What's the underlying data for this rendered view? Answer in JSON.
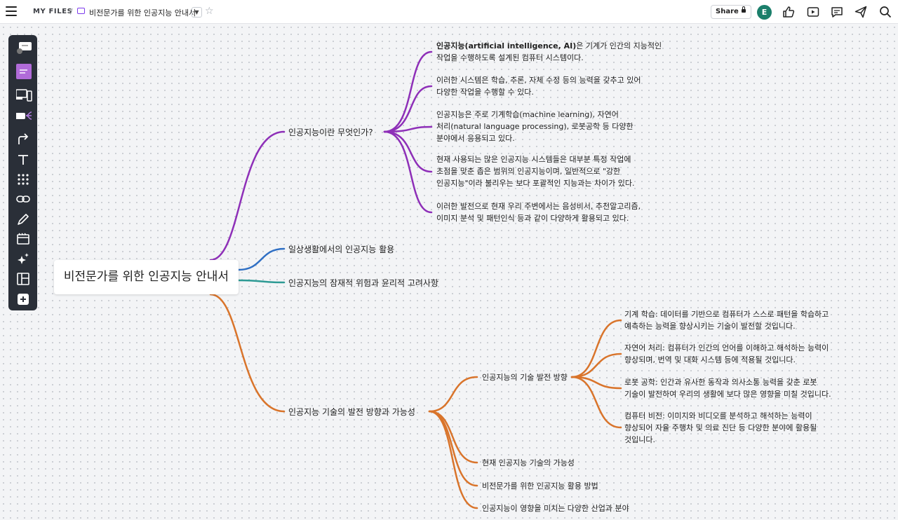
{
  "topbar": {
    "section": "MY FILES",
    "separator": "/",
    "title": "비전문가를 위한 인공지능 안내서",
    "share_label": "Share",
    "avatar_letter": "E"
  },
  "colors": {
    "purple": "#8e2fb8",
    "blue": "#2f6fc4",
    "teal": "#2d9a94",
    "orange": "#d9742b",
    "toolbar_bg": "#2a2f38",
    "avatar_bg": "#1b7f6b"
  },
  "toolbar": {
    "tools": [
      "comment-tool-icon",
      "sticky-note-icon",
      "devices-icon",
      "mindmap-icon",
      "connector-icon",
      "text-icon",
      "grid-icon",
      "link-icon",
      "pen-icon",
      "frame-icon",
      "ai-sparkle-icon",
      "layout-icon",
      "add-icon"
    ]
  },
  "mindmap": {
    "root": "비전문가를 위한 인공지능 안내서",
    "branches": [
      {
        "label": "인공지능이란 무엇인가?"
      },
      {
        "label": "일상생활에서의 인공지능 활용"
      },
      {
        "label": "인공지능의 잠재적 위험과 윤리적 고려사항"
      },
      {
        "label": "인공지능 기술의 발전 방향과 가능성"
      }
    ],
    "what_is_ai": [
      {
        "bold": "인공지능(artificial intelligence, AI)",
        "line1": "은 기계가 인간의 지능적인",
        "line2": "작업을 수행하도록 설계된 컴퓨터 시스템이다."
      },
      {
        "line1": "이러한 시스템은 학습, 추론, 자체 수정 등의 능력을 갖추고 있어",
        "line2": "다양한 작업을 수행할 수 있다."
      },
      {
        "line1": "인공지능은 주로 기계학습(machine learning), 자연어",
        "line2": "처리(natural language processing), 로봇공학 등 다양한",
        "line3": "분야에서 응용되고 있다."
      },
      {
        "line1": "현재 사용되는 많은 인공지능 시스템들은 대부분 특정 작업에",
        "line2": "초점을 맞춘 좁은 범위의 인공지능이며, 일반적으로 \"강한",
        "line3": "인공지능\"이라 불리우는 보다 포괄적인 지능과는 차이가 있다."
      },
      {
        "line1": "이러한 발전으로 현재 우리 주변에서는 음성비서, 추천알고리즘,",
        "line2": "이미지 분석 및 패턴인식 등과 같이 다양하게 활용되고 있다."
      }
    ],
    "future": {
      "children": [
        {
          "label": "인공지능의 기술 발전 방향"
        },
        {
          "label": "현재 인공지능 기술의 가능성"
        },
        {
          "label": "비전문가를 위한 인공지능 활용 방법"
        },
        {
          "label": "인공지능이 영향을 미치는 다양한 산업과 분야"
        }
      ],
      "tech_direction": [
        {
          "line1": "기계 학습: 데이터를 기반으로 컴퓨터가 스스로 패턴을 학습하고",
          "line2": "예측하는 능력을 향상시키는 기술이 발전할 것입니다."
        },
        {
          "line1": "자연어 처리: 컴퓨터가 인간의 언어를 이해하고 해석하는 능력이",
          "line2": "향상되며, 번역 및 대화 시스템 등에 적용될 것입니다."
        },
        {
          "line1": "로봇 공학: 인간과 유사한 동작과 의사소통 능력을 갖춘 로봇",
          "line2": "기술이 발전하여 우리의 생활에 보다 많은 영향을 미칠 것입니다."
        },
        {
          "line1": "컴퓨터 비전: 이미지와 비디오를 분석하고 해석하는 능력이",
          "line2": "향상되어 자율 주행차 및 의료 진단 등 다양한 분야에 활용될",
          "line3": "것입니다."
        }
      ]
    }
  }
}
